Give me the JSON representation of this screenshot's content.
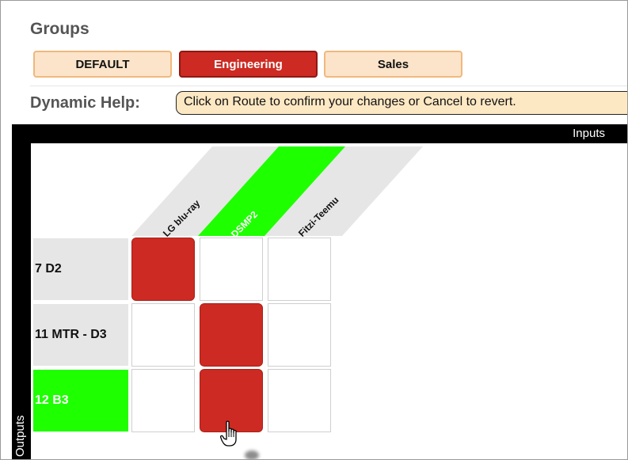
{
  "groups": {
    "title": "Groups",
    "buttons": [
      {
        "label": "DEFAULT",
        "active": false
      },
      {
        "label": "Engineering",
        "active": true
      },
      {
        "label": "Sales",
        "active": false
      }
    ]
  },
  "help": {
    "label": "Dynamic Help:",
    "text": "Click on Route to confirm your changes or Cancel to revert."
  },
  "matrix": {
    "inputs_label": "Inputs",
    "outputs_label": "Outputs",
    "inputs": [
      {
        "name": "LG blu-ray",
        "highlighted": false
      },
      {
        "name": "DSMP2",
        "highlighted": true
      },
      {
        "name": "Fitzi-Teemu",
        "highlighted": false
      }
    ],
    "outputs": [
      {
        "name": "7 D2",
        "highlighted": false,
        "routes": [
          true,
          false,
          false
        ]
      },
      {
        "name": "11 MTR - D3",
        "highlighted": false,
        "routes": [
          false,
          true,
          false
        ]
      },
      {
        "name": "12 B3",
        "highlighted": true,
        "routes": [
          false,
          true,
          false
        ]
      }
    ]
  },
  "colors": {
    "route_on": "#cc2a22",
    "highlight": "#1eff00",
    "group_button": "#fbe4c9",
    "help_box": "#fde8c4"
  },
  "icons": {
    "cursor": "hand-pointer-icon"
  }
}
